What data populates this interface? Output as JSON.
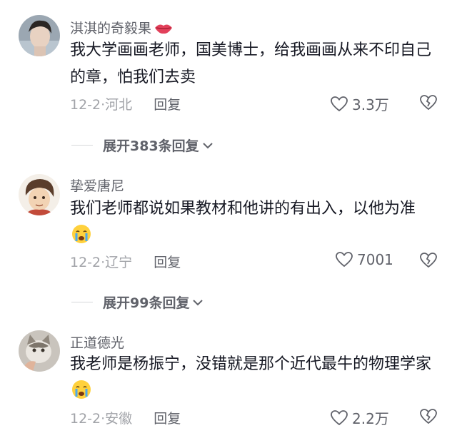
{
  "comments": [
    {
      "username": "淇淇的奇毅果",
      "content": "我大学画画老师，国美博士，给我画画从来不印自己的章，怕我们去卖",
      "date": "12-2",
      "location": "河北",
      "reply_label": "回复",
      "likes": "3.3万",
      "expand_label": "展开383条回复"
    },
    {
      "username": "挚爱唐尼",
      "content": "我们老师都说如果教材和他讲的有出入，以他为准",
      "date": "12-2",
      "location": "辽宁",
      "reply_label": "回复",
      "likes": "7001",
      "expand_label": "展开99条回复"
    },
    {
      "username": "正道德光",
      "content": "我老师是杨振宁，没错就是那个近代最牛的物理学家",
      "date": "12-2",
      "location": "安徽",
      "reply_label": "回复",
      "likes": "2.2万"
    }
  ],
  "meta_separator": "·",
  "icons": {
    "like": "heart-outline-icon",
    "dislike": "broken-heart-icon",
    "expand": "chevron-down-icon",
    "crying_emoji": "crying-face-emoji",
    "lips_emoji": "lips-emoji"
  },
  "colors": {
    "text_primary": "#161823",
    "text_secondary": "#60626a",
    "text_tertiary": "#a1a3a8"
  }
}
